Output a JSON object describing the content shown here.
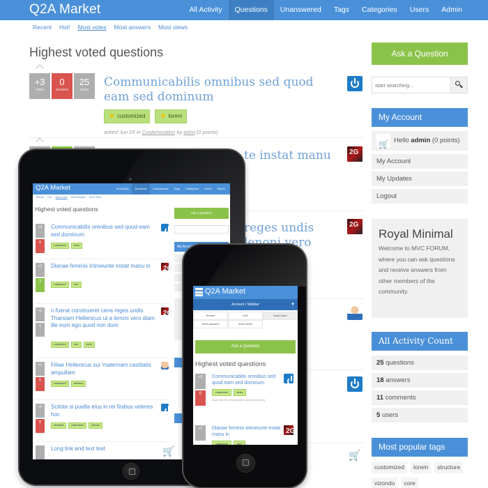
{
  "header": {
    "brand": "Q2A Market",
    "nav": [
      {
        "label": "All Activity",
        "active": false
      },
      {
        "label": "Questions",
        "active": true
      },
      {
        "label": "Unanswered",
        "active": false
      },
      {
        "label": "Tags",
        "active": false
      },
      {
        "label": "Categories",
        "active": false
      },
      {
        "label": "Users",
        "active": false
      },
      {
        "label": "Admin",
        "active": false
      }
    ]
  },
  "subnav": [
    {
      "label": "Recent",
      "active": false
    },
    {
      "label": "Hot!",
      "active": false
    },
    {
      "label": "Most votes",
      "active": true
    },
    {
      "label": "Most answers",
      "active": false
    },
    {
      "label": "Most views",
      "active": false
    }
  ],
  "page_title": "Highest voted questions",
  "questions": [
    {
      "votes": "+3",
      "votes_label": "votes",
      "answers": "0",
      "answers_label": "answers",
      "views": "25",
      "views_label": "views",
      "title": "Communicabilis omnibus sed quod eam sed dominum",
      "tags": [
        "customized",
        "lorem"
      ],
      "meta_prefix": "asked Jun 29 in",
      "category": "Customization",
      "meta_by": "by",
      "author": "artist",
      "points": "(0 points)",
      "avatar": "power-icon"
    },
    {
      "title_visible": "te instat manu",
      "avatar": "2g-logo"
    },
    {
      "title_visible_line1": "reges undis",
      "title_visible_line2": "lenoni vero",
      "avatar": "2g-logo"
    },
    {
      "avatar": "man-avatar"
    },
    {
      "avatar": "power-icon"
    },
    {
      "avatar": "cart-logo"
    }
  ],
  "sidebar": {
    "ask_button": "Ask a Question",
    "search_placeholder": "start searching...",
    "account": {
      "title": "My Account",
      "hello": "Hello",
      "username": "admin",
      "points": "(0 points)",
      "links": [
        "My Account",
        "My Updates",
        "Logout"
      ]
    },
    "about": {
      "title": "Royal Minimal",
      "text": "Welcome to MVC FORUM, where you can ask questions and receive answers from other members of the community."
    },
    "activity": {
      "title": "All Activity Count",
      "items": [
        {
          "count": "25",
          "label": "questions"
        },
        {
          "count": "18",
          "label": "answers"
        },
        {
          "count": "11",
          "label": "comments"
        },
        {
          "count": "5",
          "label": "users"
        }
      ]
    },
    "popular_tags": {
      "title": "Most popular tags",
      "tags": [
        "customized",
        "lorem",
        "structure",
        "vizondo",
        "core"
      ]
    }
  },
  "tablet": {
    "brand": "Q2A Market",
    "nav": [
      "All Activity",
      "Questions",
      "Unanswered",
      "Tags",
      "Categories",
      "Users",
      "Admin"
    ],
    "subnav": [
      "Recent",
      "Hot!",
      "Most votes",
      "Most answers",
      "Most views"
    ],
    "page_title": "Highest voted questions",
    "ask_button": "Ask a Question",
    "account_title": "My Account",
    "questions": [
      {
        "votes": "+3",
        "answers": "0",
        "title": "Communicabilis omnibus sed quod eam sed dominum",
        "tags": [
          "customized",
          "lorem"
        ]
      },
      {
        "votes": "+1",
        "answers": "3",
        "title": "Dianae feminis introeunte instat manu in",
        "tags": [
          "customized",
          "core"
        ]
      },
      {
        "votes": "+1",
        "answers": "1",
        "title": "n fuerat construeret cena reges undis Tharsiam Hellenicus ut a lenoni vero diam ille eum ego quod non dum",
        "tags": [
          "customized",
          "core",
          "lorem"
        ]
      },
      {
        "votes": "+1",
        "answers": "0",
        "title": "Filiae Hellenicus sui 'maternam castitatis ampullam",
        "tags": [
          "customized",
          "structure"
        ]
      },
      {
        "votes": "+1",
        "answers": "0",
        "title": "Scitote si puella eius in rei finibus veteres hoc",
        "tags": [
          "elements",
          "customized",
          "vizondo"
        ]
      },
      {
        "votes": "",
        "answers": "",
        "title": "Long link and text test",
        "tags": []
      }
    ]
  },
  "phone": {
    "brand": "Q2A Market",
    "account_toggle": "Account / Sidebar",
    "tabs": [
      {
        "label": "Recent",
        "active": false
      },
      {
        "label": "Hot!",
        "active": false
      },
      {
        "label": "Most votes",
        "active": true
      },
      {
        "label": "Most answers",
        "active": false
      },
      {
        "label": "Most views",
        "active": false
      }
    ],
    "ask_button": "Ask a Question",
    "page_title": "Highest voted questions",
    "questions": [
      {
        "votes": "+3",
        "answers": "0",
        "title": "Communicabilis omnibus sed quod eam sed dominum",
        "tags": [
          "customized",
          "lorem"
        ],
        "meta": "asked Jun 29 in Customization by artist (0 points)"
      },
      {
        "votes": "+1",
        "answers": "",
        "title": "Dianae feminis introeunte instat manu in",
        "tags": [
          "customized",
          "core"
        ],
        "meta": ""
      }
    ]
  }
}
